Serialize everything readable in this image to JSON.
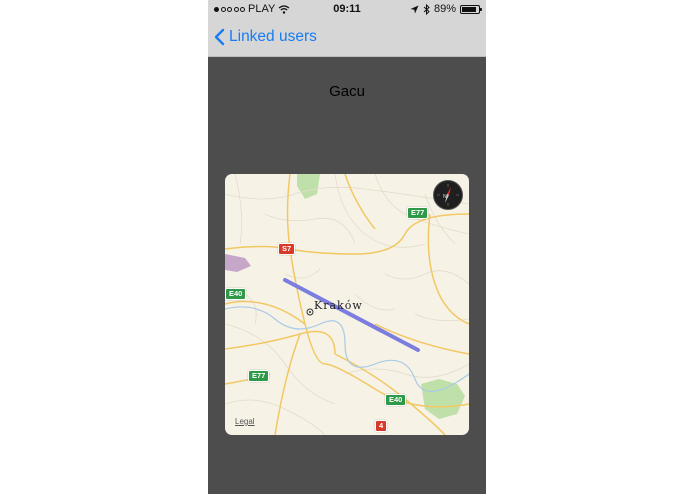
{
  "status_bar": {
    "carrier": "PLAY",
    "time": "09:11",
    "battery": "89%",
    "battery_level": 0.89,
    "signal_bars_filled": 1,
    "signal_bars_total": 5
  },
  "nav": {
    "back_label": "Linked users"
  },
  "user": {
    "name": "Gacu"
  },
  "map": {
    "city": "Kraków",
    "legal": "Legal",
    "road_shields": [
      {
        "label": "E77",
        "color": "green"
      },
      {
        "label": "S7",
        "color": "red"
      },
      {
        "label": "E40",
        "color": "green"
      },
      {
        "label": "E77",
        "color": "green"
      },
      {
        "label": "E40",
        "color": "green"
      },
      {
        "label": "4",
        "color": "red"
      }
    ],
    "route_color": "#7b7ddf"
  },
  "colors": {
    "accent": "#1a7cf2",
    "background": "#4d4d4d"
  }
}
